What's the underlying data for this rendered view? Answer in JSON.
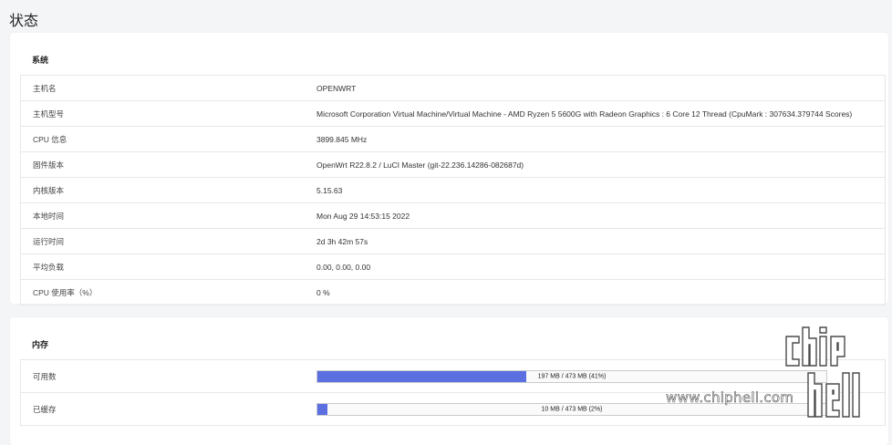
{
  "page": {
    "title": "状态"
  },
  "system": {
    "title": "系统",
    "rows": [
      {
        "label": "主机名",
        "value": "OPENWRT"
      },
      {
        "label": "主机型号",
        "value": "Microsoft Corporation Virtual Machine/Virtual Machine - AMD Ryzen 5 5600G with Radeon Graphics : 6 Core 12 Thread (CpuMark : 307634.379744 Scores)"
      },
      {
        "label": "CPU 信息",
        "value": "3899.845 MHz"
      },
      {
        "label": "固件版本",
        "value": "OpenWrt R22.8.2 / LuCI Master (git-22.236.14286-082687d)"
      },
      {
        "label": "内核版本",
        "value": "5.15.63"
      },
      {
        "label": "本地时间",
        "value": "Mon Aug 29 14:53:15 2022"
      },
      {
        "label": "运行时间",
        "value": "2d 3h 42m 57s"
      },
      {
        "label": "平均负载",
        "value": "0.00, 0.00, 0.00"
      },
      {
        "label": "CPU 使用率（%）",
        "value": "0 %"
      }
    ]
  },
  "memory": {
    "title": "内存",
    "rows": [
      {
        "label": "可用数",
        "text": "197 MB / 473 MB (41%)",
        "fraction": 0.41
      },
      {
        "label": "已缓存",
        "text": "10 MB / 473 MB (2%)",
        "fraction": 0.02
      }
    ]
  },
  "watermark": {
    "logo_text": "chip hell",
    "site": "www.chiphell.com"
  },
  "colors": {
    "progress_fill": "#5b6fe0",
    "background": "#f4f5f7",
    "card": "#ffffff"
  }
}
